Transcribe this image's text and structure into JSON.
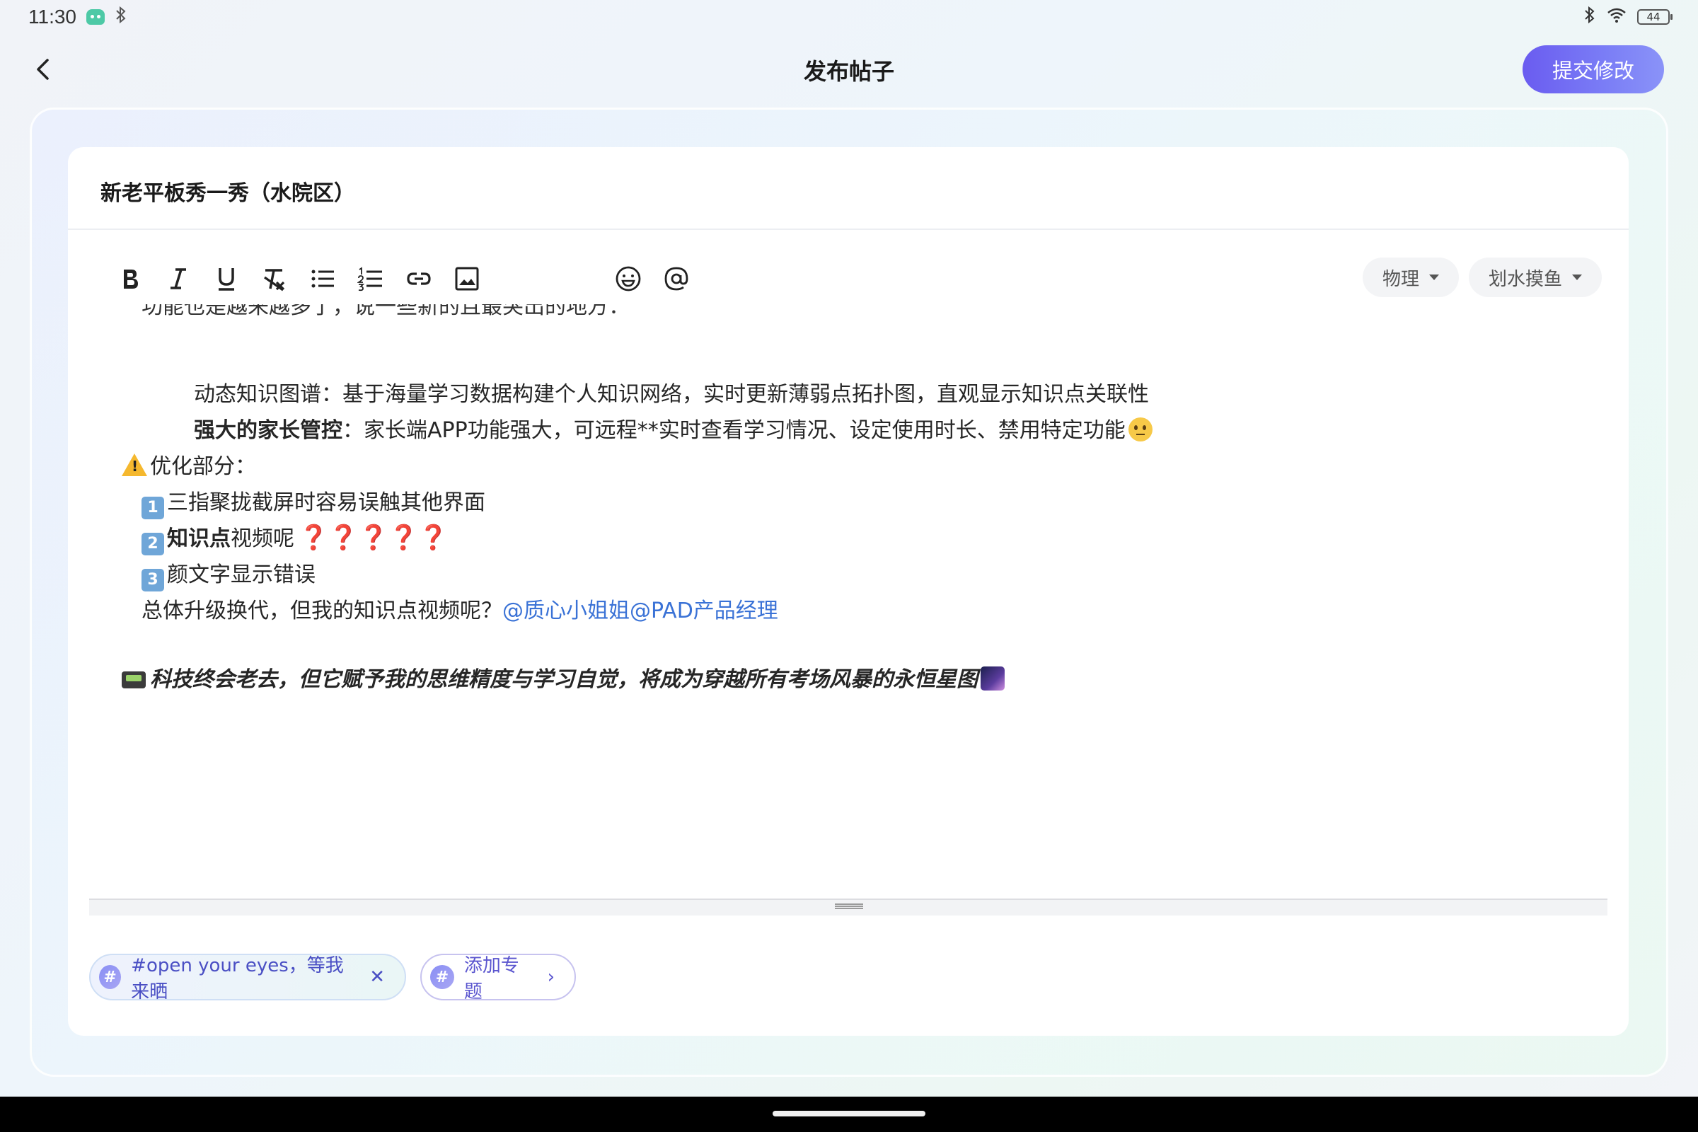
{
  "status": {
    "time": "11:30",
    "battery": "44"
  },
  "header": {
    "title": "发布帖子",
    "submit_label": "提交修改"
  },
  "post": {
    "title": "新老平板秀一秀（水院区）"
  },
  "toolbar": {
    "icons": [
      "bold-icon",
      "italic-icon",
      "underline-icon",
      "clear-format-icon",
      "bullet-list-icon",
      "numbered-list-icon",
      "link-icon",
      "image-icon",
      "emoji-icon",
      "mention-icon"
    ]
  },
  "tags": {
    "subject": "物理",
    "category": "划水摸鱼"
  },
  "content": {
    "partial_line": "功能也是越来越多了，说一些新的且最突出的地方：",
    "line1": "动态知识图谱：基于海量学习数据构建个人知识网络，实时更新薄弱点拓扑图，直观显示知识点关联性",
    "line2_bold": "强大的家长管控",
    "line2_rest": "：家长端APP功能强大，可远程**实时查看学习情况、设定使用时长、禁用特定功能",
    "optimize_label": "优化部分：",
    "item1_num": "1",
    "item1_text": "三指聚拢截屏时容易误触其他界面",
    "item2_num": "2",
    "item2_bold": "知识点",
    "item2_rest": "视频呢",
    "item2_marks": "❓❓❓❓❓",
    "item3_num": "3",
    "item3_text": "颜文字显示错误",
    "summary_text": "总体升级换代，但我的知识点视频呢？",
    "summary_mention": "@质心小姐姐@PAD产品经理",
    "closing": "科技终会老去，但它赋予我的思维精度与学习自觉，将成为穿越所有考场风暴的永恒星图"
  },
  "topics": {
    "current": "#open your eyes，等我来晒",
    "add_label": "添加专题"
  },
  "colors": {
    "accent": "#6a5cf0",
    "mention": "#3a72d6",
    "topic_text": "#4a4fc4"
  }
}
